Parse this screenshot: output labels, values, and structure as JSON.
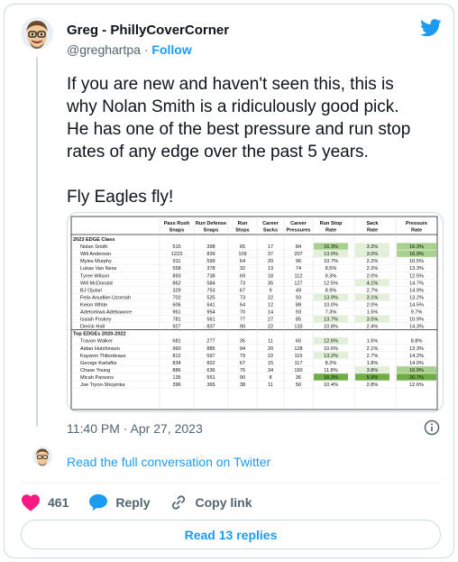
{
  "author": {
    "name": "Greg - PhillyCoverCorner",
    "handle": "@greghartpa",
    "separator": "·",
    "follow_label": "Follow"
  },
  "tweet": {
    "text": "If you are new and haven't seen this, this is\nwhy Nolan Smith is a ridiculously good pick.\nHe has one of the best pressure and run stop\nrates of any edge over the past 5 years.\n\nFly Eagles fly!",
    "timestamp": "11:40 PM · Apr 27, 2023"
  },
  "read_conversation": "Read the full conversation on Twitter",
  "actions": {
    "like_count": "461",
    "reply_label": "Reply",
    "copy_link_label": "Copy link"
  },
  "read_replies": "Read 13 replies",
  "colors": {
    "accent": "#1d9bf0",
    "like": "#f91880",
    "text_secondary": "#536471",
    "heat_light": "#e2f0d9",
    "heat_mid": "#a9d18e",
    "heat_dark": "#70ad47"
  },
  "table": {
    "headers": [
      [
        "",
        ""
      ],
      [
        "Pass Rush",
        "Snaps"
      ],
      [
        "Run Defense",
        "Snaps"
      ],
      [
        "Run",
        "Stops"
      ],
      [
        "Career",
        "Sacks"
      ],
      [
        "Career",
        "Pressures"
      ],
      [
        "Run Stop",
        "Rate"
      ],
      [
        "Sack",
        "Rate"
      ],
      [
        "Pressure",
        "Rate"
      ]
    ],
    "sections": [
      {
        "title": "2023 EDGE Class",
        "rows": [
          {
            "cells": [
              "Nolan Smith",
              "515",
              "398",
              "65",
              "17",
              "84",
              "16.3%",
              "3.3%",
              "16.3%"
            ],
            "heat": [
              0,
              0,
              0,
              0,
              0,
              0,
              2,
              1,
              2
            ]
          },
          {
            "cells": [
              "Will Anderson",
              "1223",
              "839",
              "109",
              "37",
              "207",
              "13.0%",
              "3.0%",
              "16.9%"
            ],
            "heat": [
              0,
              0,
              0,
              0,
              0,
              0,
              1,
              1,
              2
            ]
          },
          {
            "cells": [
              "Myles Murphy",
              "911",
              "599",
              "64",
              "20",
              "96",
              "10.7%",
              "2.2%",
              "10.5%"
            ],
            "heat": [
              0,
              0,
              0,
              0,
              0,
              0,
              0,
              0,
              0
            ]
          },
          {
            "cells": [
              "Lukas Van Ness",
              "558",
              "378",
              "32",
              "13",
              "74",
              "8.5%",
              "2.3%",
              "13.3%"
            ],
            "heat": [
              0,
              0,
              0,
              0,
              0,
              0,
              0,
              0,
              0
            ]
          },
          {
            "cells": [
              "Tyree Wilson",
              "893",
              "738",
              "69",
              "18",
              "112",
              "9.3%",
              "2.0%",
              "12.5%"
            ],
            "heat": [
              0,
              0,
              0,
              0,
              0,
              0,
              0,
              0,
              0
            ]
          },
          {
            "cells": [
              "Will McDonald",
              "862",
              "584",
              "73",
              "35",
              "127",
              "12.5%",
              "4.1%",
              "14.7%"
            ],
            "heat": [
              0,
              0,
              0,
              0,
              0,
              0,
              0,
              1,
              0
            ]
          },
          {
            "cells": [
              "BJ Ojulari",
              "329",
              "753",
              "67",
              "9",
              "49",
              "8.9%",
              "2.7%",
              "14.9%"
            ],
            "heat": [
              0,
              0,
              0,
              0,
              0,
              0,
              0,
              0,
              0
            ]
          },
          {
            "cells": [
              "Felix Anudike-Uzomah",
              "702",
              "525",
              "73",
              "22",
              "93",
              "13.9%",
              "3.1%",
              "13.2%"
            ],
            "heat": [
              0,
              0,
              0,
              0,
              0,
              0,
              1,
              1,
              0
            ]
          },
          {
            "cells": [
              "Keion White",
              "606",
              "641",
              "64",
              "12",
              "88",
              "10.0%",
              "2.0%",
              "14.5%"
            ],
            "heat": [
              0,
              0,
              0,
              0,
              0,
              0,
              0,
              0,
              0
            ]
          },
          {
            "cells": [
              "Adetomiwa Adebawore",
              "961",
              "954",
              "70",
              "14",
              "93",
              "7.3%",
              "1.5%",
              "9.7%"
            ],
            "heat": [
              0,
              0,
              0,
              0,
              0,
              0,
              0,
              0,
              0
            ]
          },
          {
            "cells": [
              "Isaiah Foskey",
              "781",
              "561",
              "77",
              "27",
              "85",
              "13.7%",
              "3.5%",
              "10.9%"
            ],
            "heat": [
              0,
              0,
              0,
              0,
              0,
              0,
              1,
              1,
              0
            ]
          },
          {
            "cells": [
              "Derick Hall",
              "927",
              "837",
              "90",
              "22",
              "133",
              "10.8%",
              "2.4%",
              "14.3%"
            ],
            "heat": [
              0,
              0,
              0,
              0,
              0,
              0,
              0,
              0,
              0
            ]
          }
        ]
      },
      {
        "title": "Top EDGEs 2020-2022",
        "rows": [
          {
            "cells": [
              "Travon Walker",
              "681",
              "277",
              "35",
              "11",
              "60",
              "12.6%",
              "1.6%",
              "8.8%"
            ],
            "heat": [
              0,
              0,
              0,
              0,
              0,
              0,
              1,
              0,
              0
            ]
          },
          {
            "cells": [
              "Aidan Hutchinson",
              "960",
              "885",
              "94",
              "20",
              "128",
              "10.6%",
              "2.1%",
              "13.3%"
            ],
            "heat": [
              0,
              0,
              0,
              0,
              0,
              0,
              0,
              0,
              0
            ]
          },
          {
            "cells": [
              "Kaywon Thibodeaux",
              "812",
              "597",
              "79",
              "22",
              "115",
              "13.2%",
              "2.7%",
              "14.2%"
            ],
            "heat": [
              0,
              0,
              0,
              0,
              0,
              0,
              1,
              0,
              0
            ]
          },
          {
            "cells": [
              "George Karlaftis",
              "834",
              "822",
              "67",
              "15",
              "117",
              "8.2%",
              "1.8%",
              "14.0%"
            ],
            "heat": [
              0,
              0,
              0,
              0,
              0,
              0,
              0,
              0,
              0
            ]
          },
          {
            "cells": [
              "Chase Young",
              "886",
              "636",
              "75",
              "34",
              "150",
              "11.8%",
              "3.8%",
              "16.9%"
            ],
            "heat": [
              0,
              0,
              0,
              0,
              0,
              0,
              0,
              1,
              2
            ]
          },
          {
            "cells": [
              "Micah Parsons",
              "135",
              "551",
              "90",
              "8",
              "36",
              "16.3%",
              "5.9%",
              "26.7%"
            ],
            "heat": [
              0,
              0,
              0,
              0,
              0,
              0,
              3,
              3,
              3
            ]
          },
          {
            "cells": [
              "Joe Tryon-Shoyinka",
              "396",
              "365",
              "38",
              "11",
              "50",
              "10.4%",
              "2.8%",
              "12.6%"
            ],
            "heat": [
              0,
              0,
              0,
              0,
              0,
              0,
              0,
              0,
              0
            ]
          }
        ]
      }
    ]
  }
}
